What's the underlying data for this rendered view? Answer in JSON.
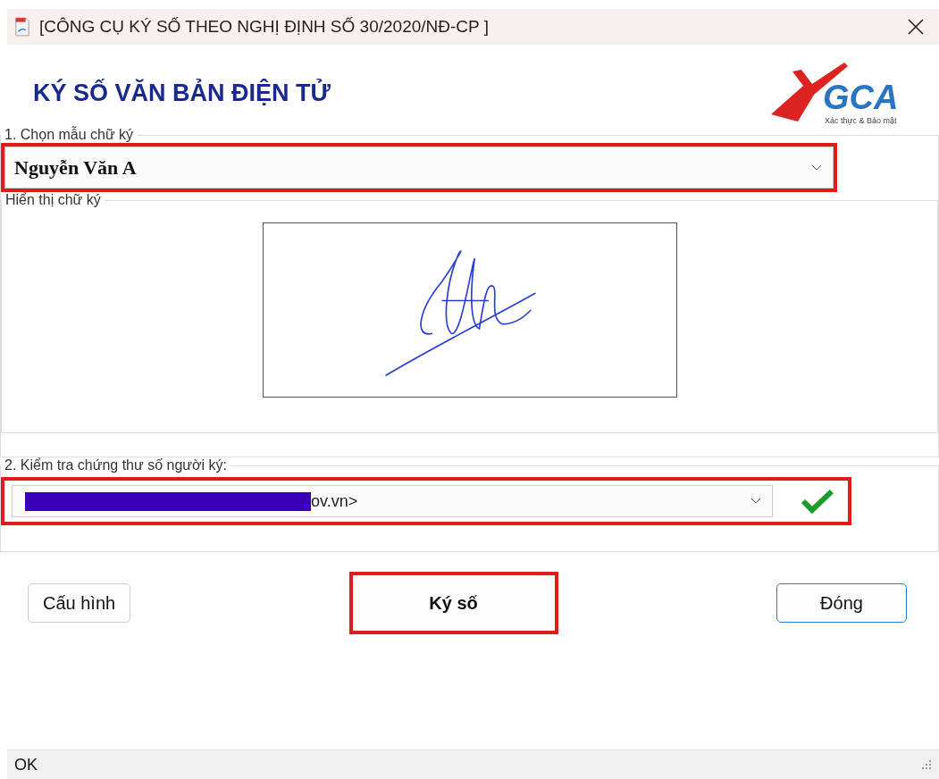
{
  "window": {
    "title": "[CÔNG CỤ KÝ SỐ THEO NGHỊ ĐỊNH SỐ 30/2020/NĐ-CP ]"
  },
  "heading": "KÝ SỐ VĂN BẢN ĐIỆN TỬ",
  "logo": {
    "text": "GCA",
    "tagline": "Xác thực & Bảo mật"
  },
  "signature_section": {
    "legend": "1. Chọn mẫu chữ ký",
    "template": {
      "value": "Nguyễn Văn A",
      "highlighted": true
    },
    "preview": {
      "legend": "Hiển thị chữ ký"
    }
  },
  "certificate_section": {
    "legend": "2. Kiểm tra chứng thư số người ký:",
    "certificate": {
      "value": "ov.vn>",
      "redacted": true,
      "highlighted": true
    },
    "valid": true
  },
  "buttons": [
    {
      "label": "Cấu hình",
      "highlighted": false,
      "default": false
    },
    {
      "label": "Ký số",
      "highlighted": true,
      "default": false
    },
    {
      "label": "Đóng",
      "highlighted": false,
      "default": true
    }
  ],
  "status_bar": {
    "text": "OK"
  }
}
